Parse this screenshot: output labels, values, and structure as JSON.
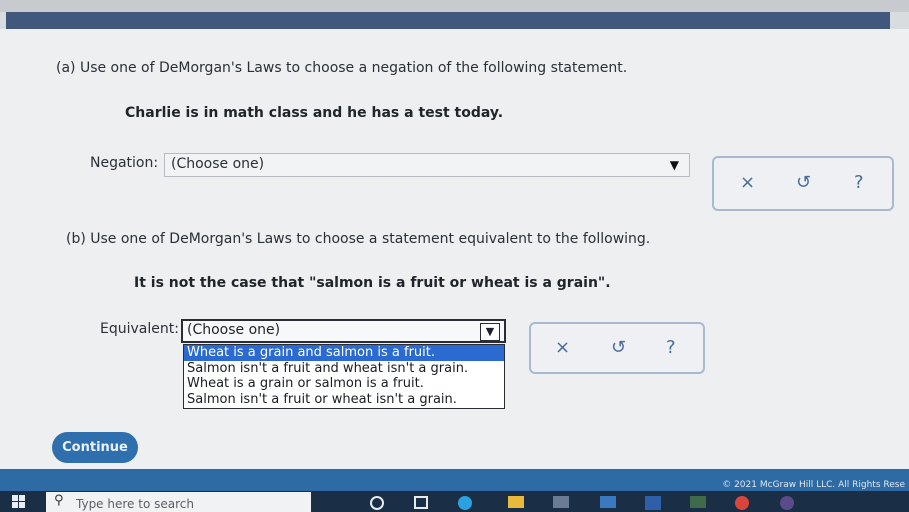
{
  "part_a": {
    "question": "(a) Use one of DeMorgan's Laws to choose a negation of the following statement.",
    "statement": "Charlie is in math class and he has a test today.",
    "label": "Negation:",
    "select_value": "(Choose one)"
  },
  "part_b": {
    "question": "(b) Use one of DeMorgan's Laws to choose a statement equivalent to the following.",
    "statement": "It is not the case that \"salmon is a fruit or wheat is a grain\".",
    "label": "Equivalent:",
    "select_value": "(Choose one)",
    "options": [
      "Wheat is a grain and salmon is a fruit.",
      "Salmon isn't a fruit and wheat isn't a grain.",
      "Wheat is a grain or salmon is a fruit.",
      "Salmon isn't a fruit or wheat isn't a grain."
    ],
    "highlighted_option_index": 0
  },
  "tools": {
    "clear": "×",
    "undo": "↺",
    "help": "?"
  },
  "continue_label": "Continue",
  "copyright": "© 2021 McGraw Hill LLC. All Rights Rese",
  "taskbar": {
    "search_placeholder": "Type here to search"
  },
  "colors": {
    "header": "#41577c",
    "footer": "#2e6aa4",
    "continue_button": "#2f6fae",
    "highlight": "#2b6bd1",
    "tool_icons": "#4a6c9a"
  }
}
